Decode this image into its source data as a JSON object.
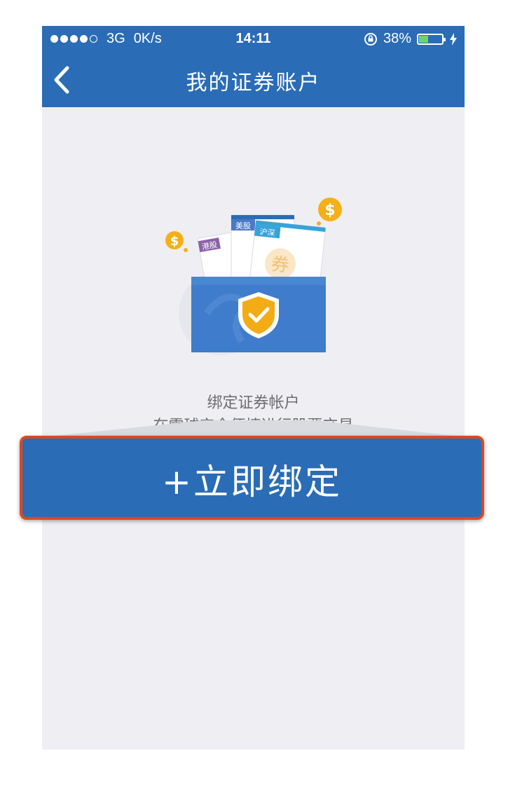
{
  "status_bar": {
    "carrier_signal": "●●●●○",
    "network": "3G",
    "speed": "0K/s",
    "time": "14:11",
    "battery_percent": "38%",
    "battery_level": 0.38
  },
  "nav": {
    "title": "我的证券账户"
  },
  "illustration": {
    "tag_hk": "港股",
    "tag_us": "美股",
    "tag_sh": "沪深",
    "coupon": "券",
    "coin_symbol": "$"
  },
  "description": {
    "line1": "绑定证券帐户",
    "line2": "在雪球安全便捷进行股票交易"
  },
  "bind_button": {
    "label": "+立即绑定"
  },
  "colors": {
    "primary": "#2a6cb6",
    "highlight_border": "#e2461e",
    "background": "#efeff3",
    "shield": "#f3ab16"
  }
}
